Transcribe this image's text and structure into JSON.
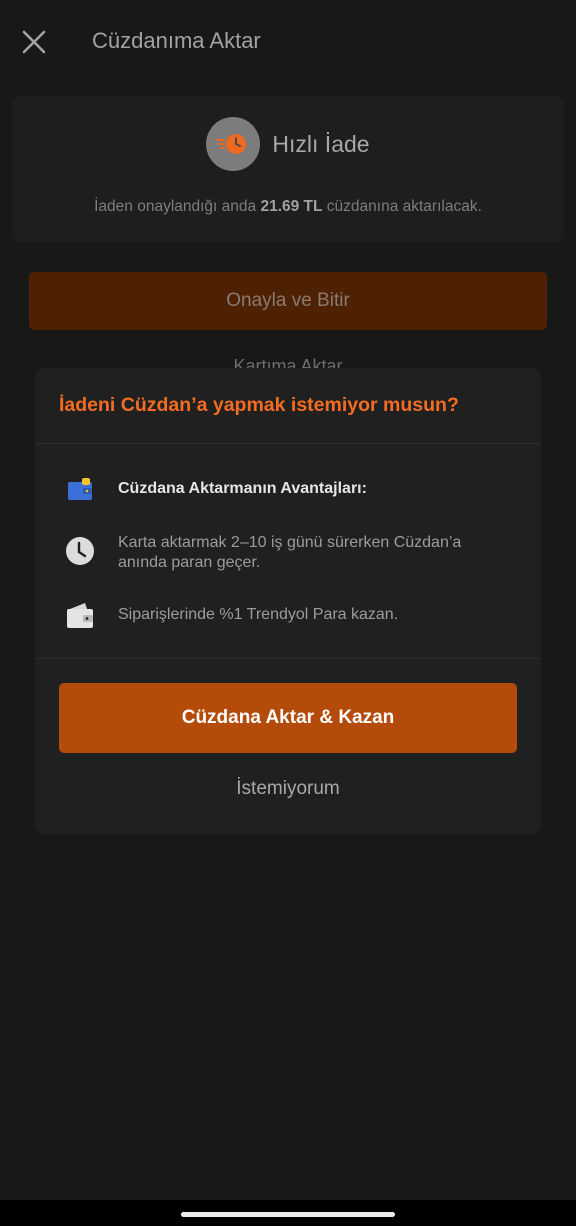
{
  "header": {
    "title": "Cüzdanıma Aktar",
    "close_icon": "close-icon"
  },
  "refund_card": {
    "icon": "fast-clock-icon",
    "title": "Hızlı İade",
    "desc_prefix": "İaden onaylandığı anda ",
    "amount": "21.69 TL",
    "desc_suffix": " cüzdanına aktarılacak."
  },
  "actions": {
    "confirm_label": "Onayla ve Bitir",
    "transfer_card_label": "Kartıma Aktar"
  },
  "modal": {
    "title": "İadeni Cüzdan’a yapmak istemiyor musun?",
    "benefits": [
      {
        "icon": "wallet-icon",
        "text": "Cüzdana Aktarmanın Avantajları:"
      },
      {
        "icon": "clock-icon",
        "text": "Karta aktarmak 2–10 iş günü sürerken Cüzdan’a anında paran geçer."
      },
      {
        "icon": "wallet-cash-icon",
        "text": "Siparişlerinde %1 Trendyol Para kazan."
      }
    ],
    "primary_label": "Cüzdana Aktar & Kazan",
    "decline_label": "İstemiyorum"
  },
  "colors": {
    "accent": "#f36c22",
    "primary_button": "#b54b0a",
    "background": "#181818",
    "modal": "#202020"
  }
}
